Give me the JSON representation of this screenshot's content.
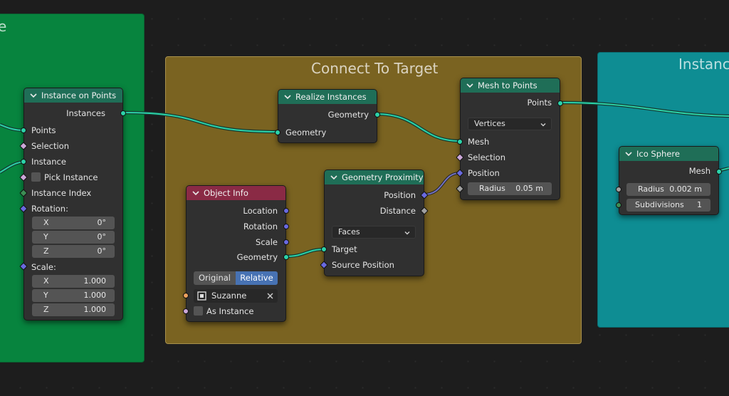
{
  "frames": {
    "left_title": "e",
    "center_title": "Connect To Target",
    "right_title": "Instanc"
  },
  "colors": {
    "geometry_socket": "#2cd3a9",
    "vector_socket": "#6a6ae0",
    "float_socket": "#a1a1a1",
    "integer_socket": "#3d8e55",
    "boolean_socket": "#cba7d8",
    "object_socket": "#eda25e",
    "header_geometry": "#1f6e57",
    "header_input": "#8a2a45",
    "frame_green": "#07843e",
    "frame_gold": "#7a6321",
    "frame_teal": "#0e8d93"
  },
  "instance_on_points": {
    "title": "Instance on Points",
    "out_instances": "Instances",
    "in_points": "Points",
    "in_selection": "Selection",
    "in_instance": "Instance",
    "in_pick_instance": "Pick Instance",
    "in_instance_index": "Instance Index",
    "rotation_label": "Rotation:",
    "rotation": [
      {
        "axis": "X",
        "value": "0°"
      },
      {
        "axis": "Y",
        "value": "0°"
      },
      {
        "axis": "Z",
        "value": "0°"
      }
    ],
    "scale_label": "Scale:",
    "scale": [
      {
        "axis": "X",
        "value": "1.000"
      },
      {
        "axis": "Y",
        "value": "1.000"
      },
      {
        "axis": "Z",
        "value": "1.000"
      }
    ]
  },
  "realize_instances": {
    "title": "Realize Instances",
    "out_geometry": "Geometry",
    "in_geometry": "Geometry"
  },
  "object_info": {
    "title": "Object Info",
    "out_location": "Location",
    "out_rotation": "Rotation",
    "out_scale": "Scale",
    "out_geometry": "Geometry",
    "toggle_original": "Original",
    "toggle_relative": "Relative",
    "object_value": "Suzanne",
    "in_as_instance": "As Instance"
  },
  "geometry_proximity": {
    "title": "Geometry Proximity",
    "out_position": "Position",
    "out_distance": "Distance",
    "mode": "Faces",
    "in_target": "Target",
    "in_source_position": "Source Position"
  },
  "mesh_to_points": {
    "title": "Mesh to Points",
    "out_points": "Points",
    "mode": "Vertices",
    "in_mesh": "Mesh",
    "in_selection": "Selection",
    "in_position": "Position",
    "radius_label": "Radius",
    "radius_value": "0.05 m"
  },
  "ico_sphere": {
    "title": "Ico Sphere",
    "out_mesh": "Mesh",
    "radius_label": "Radius",
    "radius_value": "0.002 m",
    "subdivisions_label": "Subdivisions",
    "subdivisions_value": "1"
  }
}
